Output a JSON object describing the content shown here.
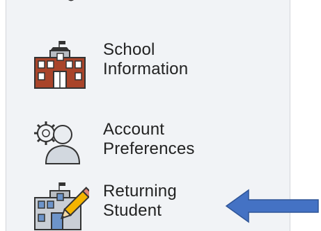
{
  "sidebar": {
    "items": [
      {
        "line1": "School",
        "line2": "Information",
        "icon": "school-building-icon"
      },
      {
        "line1": "Account",
        "line2": "Preferences",
        "icon": "user-gear-icon"
      },
      {
        "line1": "Returning",
        "line2": "Student",
        "icon": "school-pencil-icon"
      }
    ]
  },
  "annotation": {
    "arrow_color": "#4472c4",
    "arrow_direction": "left"
  },
  "colors": {
    "sidebar_bg": "#f1f3f6",
    "building_brown": "#8b4a1c",
    "building_gray": "#b8bcc2",
    "pencil_yellow": "#f4b400"
  }
}
